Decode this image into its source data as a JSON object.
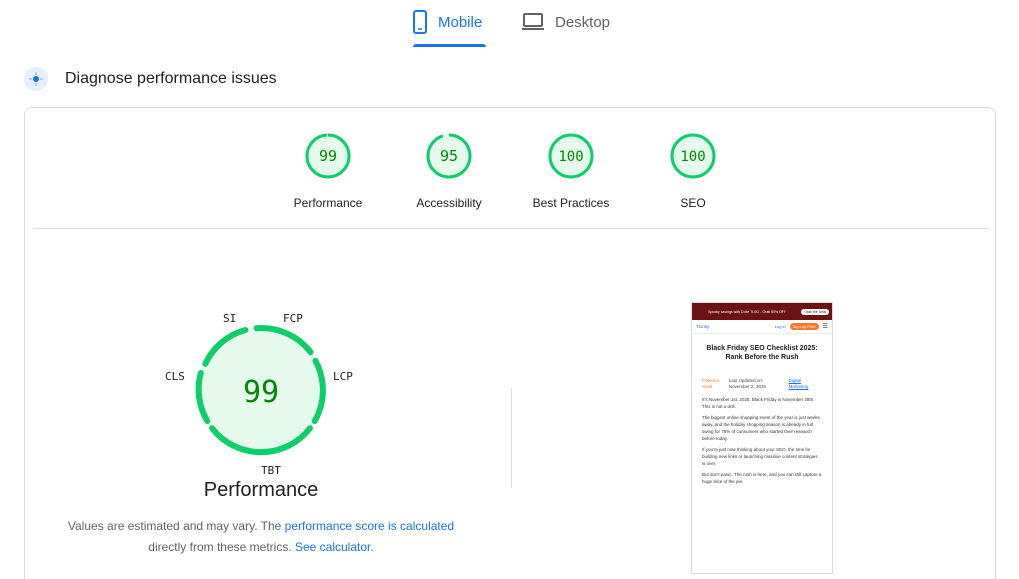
{
  "tabs": [
    {
      "label": "Mobile",
      "icon": "smartphone-icon",
      "selected": true
    },
    {
      "label": "Desktop",
      "icon": "laptop-icon",
      "selected": false
    }
  ],
  "diagnose": {
    "title": "Diagnose performance issues",
    "icon": "diagnostic-icon"
  },
  "scores": [
    {
      "value": "99",
      "label": "Performance",
      "fraction": 0.99
    },
    {
      "value": "95",
      "label": "Accessibility",
      "fraction": 0.95
    },
    {
      "value": "100",
      "label": "Best Practices",
      "fraction": 1.0
    },
    {
      "value": "100",
      "label": "SEO",
      "fraction": 1.0
    }
  ],
  "colors": {
    "pass": "#0cce6b",
    "pass_text": "#008800",
    "pass_bg": "#e6f9ed",
    "link": "#1a73e8",
    "accent": "#1a73e8"
  },
  "performance": {
    "score": "99",
    "title": "Performance",
    "metrics": {
      "si": "SI",
      "fcp": "FCP",
      "lcp": "LCP",
      "tbt": "TBT",
      "cls": "CLS"
    },
    "note_prefix": "Values are estimated and may vary. The ",
    "note_link1": "performance score is calculated",
    "note_mid": " directly from these metrics. ",
    "note_link2": "See calculator."
  },
  "screenshot": {
    "banner_text": "Spooky savings with Code TLSO - Grab 50% OFF",
    "banner_button": "Grab the Deal",
    "logo": "TLinky",
    "login": "Log in",
    "signup": "Sign up Free",
    "headline": "Black Friday SEO Checklist 2025: Rank Before the Rush",
    "author": "Caterina Scott",
    "date": "Last Updated on: November 2, 2025",
    "category": "Digital Marketing",
    "para1": "It's November 1st, 2025. Black Friday is November 28th. This is not a drill.",
    "para2": "The biggest online shopping event of the year is just weeks away, and the holiday shopping season is already in full swing for 78% of consumers who started their research before today.",
    "para3": "If you're just now thinking about your SEO, the time for building new links or launching massive content strategies is over.",
    "para4": "But don't panic. The rush is here, and you can still capture a huge slice of the pie."
  }
}
